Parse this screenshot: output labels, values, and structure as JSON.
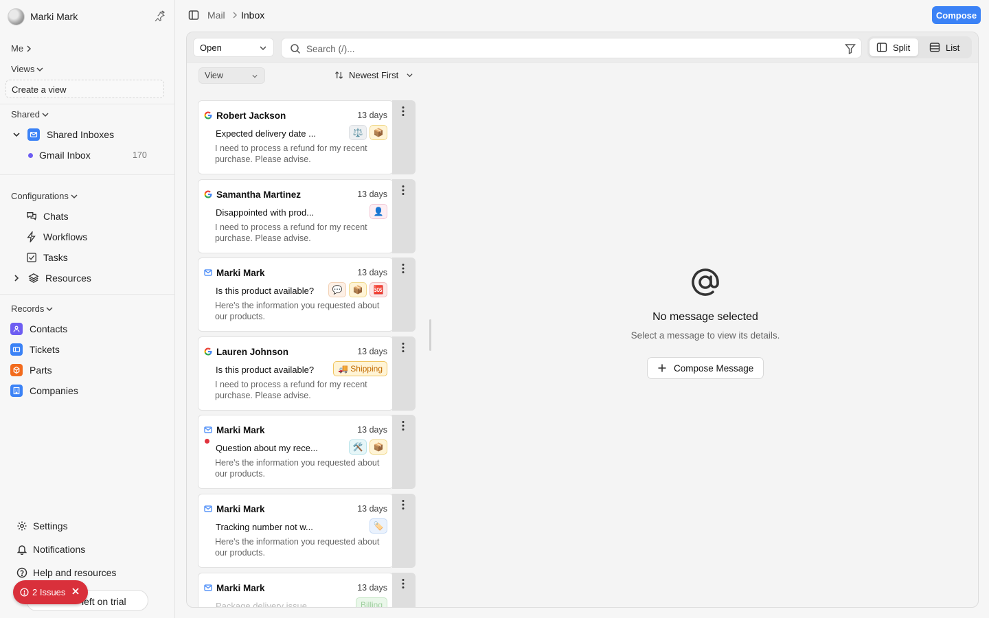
{
  "user": {
    "name": "Marki Mark"
  },
  "sidebar": {
    "me_label": "Me",
    "views_label": "Views",
    "create_view": "Create a view",
    "shared_label": "Shared",
    "shared_inboxes": "Shared Inboxes",
    "gmail_inbox": {
      "label": "Gmail Inbox",
      "count": "170"
    },
    "configurations_label": "Configurations",
    "config_items": [
      {
        "label": "Chats",
        "icon": "chat-icon"
      },
      {
        "label": "Workflows",
        "icon": "bolt-icon"
      },
      {
        "label": "Tasks",
        "icon": "checkbox-icon"
      },
      {
        "label": "Resources",
        "icon": "layers-icon"
      }
    ],
    "records_label": "Records",
    "records": [
      {
        "label": "Contacts",
        "icon": "person-icon",
        "color": "#6d5df2"
      },
      {
        "label": "Tickets",
        "icon": "ticket-icon",
        "color": "#3b82f6"
      },
      {
        "label": "Parts",
        "icon": "cube-icon",
        "color": "#f26b1d"
      },
      {
        "label": "Companies",
        "icon": "building-icon",
        "color": "#3b82f6"
      }
    ],
    "bottom": {
      "settings": "Settings",
      "notifications": "Notifications",
      "help": "Help and resources",
      "trial": "left on trial"
    },
    "issues_badge": "2 Issues"
  },
  "breadcrumb": {
    "root": "Mail",
    "current": "Inbox"
  },
  "toolbar": {
    "compose": "Compose",
    "status_select": "Open",
    "search_placeholder": "Search (/)...",
    "split": "Split",
    "list": "List",
    "view_select": "View",
    "sort": "Newest First"
  },
  "messages": [
    {
      "from": "Robert Jackson",
      "age": "13 days",
      "subject": "Expected delivery date ...",
      "preview": "I need to process a refund for my recent purchase. Please advise.",
      "source": "google"
    },
    {
      "from": "Samantha Martinez",
      "age": "13 days",
      "subject": "Disappointed with prod...",
      "preview": "I need to process a refund for my recent purchase. Please advise.",
      "source": "google"
    },
    {
      "from": "Marki Mark",
      "age": "13 days",
      "subject": "Is this product available?",
      "preview": "Here's the information you requested about our products.",
      "source": "mail"
    },
    {
      "from": "Lauren Johnson",
      "age": "13 days",
      "subject": "Is this product available?",
      "preview": "I need to process a refund for my recent purchase. Please advise.",
      "source": "google",
      "tag_label": "🚚 Shipping"
    },
    {
      "from": "Marki Mark",
      "age": "13 days",
      "subject": "Question about my rece...",
      "preview": "Here's the information you requested about our products.",
      "source": "mail",
      "unread": true
    },
    {
      "from": "Marki Mark",
      "age": "13 days",
      "subject": "Tracking number not w...",
      "preview": "Here's the information you requested about our products.",
      "source": "mail"
    },
    {
      "from": "Marki Mark",
      "age": "13 days",
      "subject": "Package delivery issue",
      "preview": "",
      "source": "mail",
      "tag_label": "Billing"
    }
  ],
  "empty_state": {
    "title": "No message selected",
    "subtitle": "Select a message to view its details.",
    "action": "Compose Message"
  },
  "colors": {
    "accent": "#3b82f6",
    "danger": "#d9303b"
  }
}
